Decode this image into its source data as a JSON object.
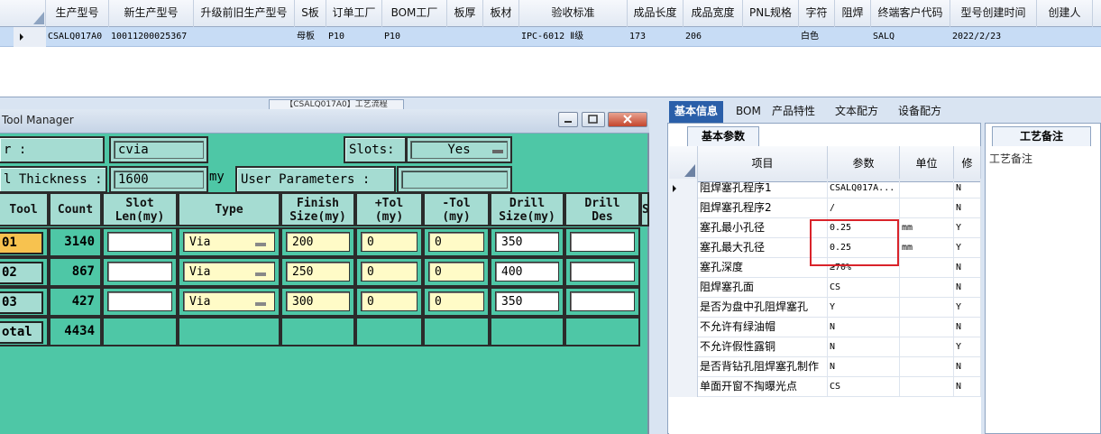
{
  "top_grid": {
    "columns": [
      "生产型号",
      "新生产型号",
      "升级前旧生产型号",
      "S板",
      "订单工厂",
      "BOM工厂",
      "板厚",
      "板材",
      "验收标准",
      "成品长度",
      "成品宽度",
      "PNL规格",
      "字符",
      "阻焊",
      "终端客户代码",
      "型号创建时间",
      "创建人"
    ],
    "row": [
      "CSALQ017A0",
      "10011200025367",
      "",
      "母板",
      "P10",
      "P10",
      "",
      "",
      "IPC-6012 Ⅱ级",
      "173",
      "206",
      "",
      "白色",
      "",
      "SALQ",
      "2022/2/23",
      ""
    ],
    "process_tab": "【CSALQ017A0】工艺流程"
  },
  "tool_manager": {
    "title": "Tool Manager",
    "layer_label": "r              :",
    "layer_value": "cvia",
    "slots_label": "Slots:",
    "slots_value": "Yes",
    "thickness_label": "l Thickness :",
    "thickness_value": "1600",
    "thickness_unit": "my",
    "user_params_label": "User Parameters :",
    "user_params_value": "",
    "headers": [
      "Tool",
      "Count",
      "Slot\nLen(my)",
      "Type",
      "Finish\nSize(my)",
      "+Tol\n(my)",
      "-Tol\n(my)",
      "Drill\nSize(my)",
      "Drill\nDes",
      "S"
    ],
    "rows": [
      {
        "tool": "01",
        "count": "3140",
        "slot_len": "",
        "type": "Via",
        "finish": "200",
        "ptol": "0",
        "mtol": "0",
        "drill": "350",
        "des": ""
      },
      {
        "tool": "02",
        "count": "867",
        "slot_len": "",
        "type": "Via",
        "finish": "250",
        "ptol": "0",
        "mtol": "0",
        "drill": "400",
        "des": ""
      },
      {
        "tool": "03",
        "count": "427",
        "slot_len": "",
        "type": "Via",
        "finish": "300",
        "ptol": "0",
        "mtol": "0",
        "drill": "350",
        "des": ""
      }
    ],
    "total_label": "otal",
    "total_count": "4434"
  },
  "right_panel": {
    "tabs": [
      "基本信息",
      "BOM",
      "产品特性",
      "文本配方",
      "设备配方"
    ],
    "active_tab": "基本信息",
    "subtab": "基本参数",
    "note_tab": "工艺备注",
    "note_label": "工艺备注",
    "headers": [
      "项目",
      "参数",
      "单位",
      "修"
    ],
    "rows": [
      {
        "item": "阻焊塞孔程序1",
        "param": "CSALQ017A...",
        "unit": "",
        "flag": "N"
      },
      {
        "item": "阻焊塞孔程序2",
        "param": "/",
        "unit": "",
        "flag": "N"
      },
      {
        "item": "塞孔最小孔径",
        "param": "0.25",
        "unit": "mm",
        "flag": "Y"
      },
      {
        "item": "塞孔最大孔径",
        "param": "0.25",
        "unit": "mm",
        "flag": "Y"
      },
      {
        "item": "塞孔深度",
        "param": "≥70%",
        "unit": "",
        "flag": "N"
      },
      {
        "item": "阻焊塞孔面",
        "param": "CS",
        "unit": "",
        "flag": "N"
      },
      {
        "item": "是否为盘中孔阻焊塞孔",
        "param": "Y",
        "unit": "",
        "flag": "Y"
      },
      {
        "item": "不允许有绿油帽",
        "param": "N",
        "unit": "",
        "flag": "N"
      },
      {
        "item": "不允许假性露铜",
        "param": "N",
        "unit": "",
        "flag": "Y"
      },
      {
        "item": "是否背钻孔阻焊塞孔制作",
        "param": "N",
        "unit": "",
        "flag": "N"
      },
      {
        "item": "单面开窗不掏曝光点",
        "param": "CS",
        "unit": "",
        "flag": "N"
      }
    ]
  },
  "colors": {
    "tool_bg": "#4ec7a6",
    "selected_tool": "#f7c24f",
    "highlight_box": "#d9232a",
    "active_tab": "#2a5fa9"
  }
}
